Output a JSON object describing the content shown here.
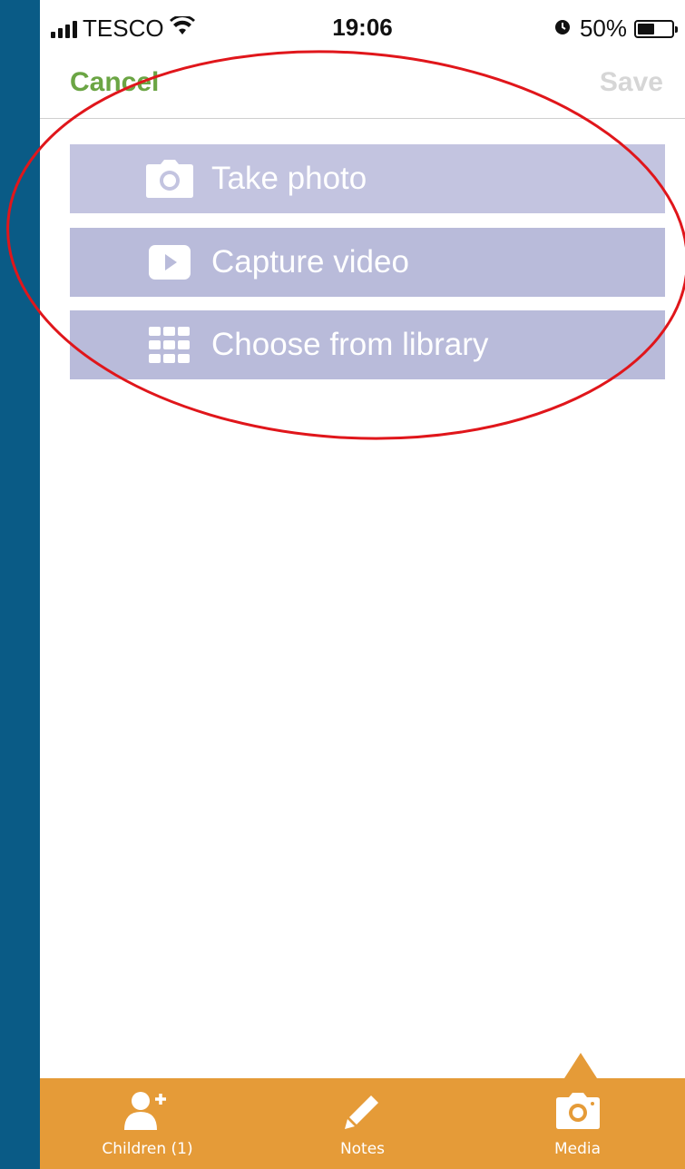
{
  "status_bar": {
    "carrier": "TESCO",
    "time": "19:06",
    "battery_percent_label": "50%",
    "battery_level": 0.5,
    "icons": [
      "signal-icon",
      "wifi-icon",
      "alarm-icon",
      "battery-icon"
    ]
  },
  "nav": {
    "cancel_label": "Cancel",
    "save_label": "Save"
  },
  "options": [
    {
      "label": "Take photo",
      "icon": "camera-icon"
    },
    {
      "label": "Capture video",
      "icon": "play-icon"
    },
    {
      "label": "Choose from library",
      "icon": "grid-icon"
    }
  ],
  "tabs": [
    {
      "label": "Children (1)",
      "icon": "add-person-icon"
    },
    {
      "label": "Notes",
      "icon": "pencil-icon"
    },
    {
      "label": "Media",
      "icon": "camera-icon",
      "selected": true
    }
  ],
  "colors": {
    "accent_green": "#6ba544",
    "tab_bar": "#e59b38",
    "option_bg": "#b9bbda",
    "annotation_red": "#e0161b",
    "frame_blue": "#0a5b86"
  }
}
